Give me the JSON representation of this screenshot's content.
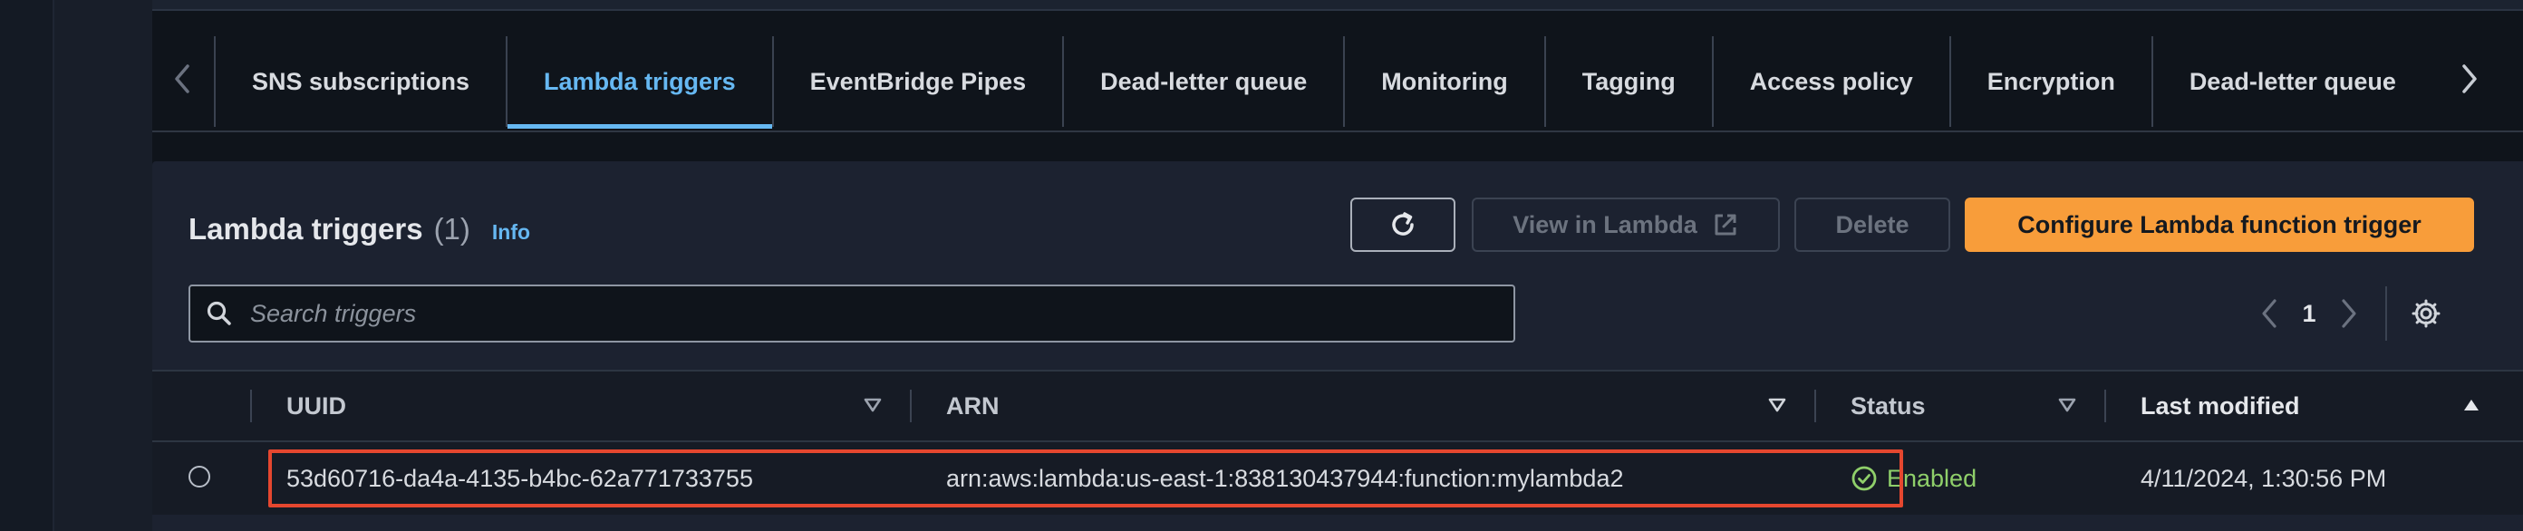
{
  "tabs": {
    "items": [
      {
        "label": "SNS subscriptions"
      },
      {
        "label": "Lambda triggers"
      },
      {
        "label": "EventBridge Pipes"
      },
      {
        "label": "Dead-letter queue"
      },
      {
        "label": "Monitoring"
      },
      {
        "label": "Tagging"
      },
      {
        "label": "Access policy"
      },
      {
        "label": "Encryption"
      },
      {
        "label": "Dead-letter queue"
      }
    ],
    "active_label": "Lambda triggers"
  },
  "panel": {
    "title": "Lambda triggers",
    "count": "(1)",
    "info_label": "Info",
    "view_label": "View in Lambda",
    "delete_label": "Delete",
    "configure_label": "Configure Lambda function trigger"
  },
  "search": {
    "placeholder": "Search triggers",
    "value": ""
  },
  "pagination": {
    "current_page": "1"
  },
  "table": {
    "columns": {
      "uuid": "UUID",
      "arn": "ARN",
      "status": "Status",
      "modified": "Last modified"
    },
    "rows": [
      {
        "uuid": "53d60716-da4a-4135-b4bc-62a771733755",
        "arn": "arn:aws:lambda:us-east-1:838130437944:function:mylambda2",
        "status": "Enabled",
        "modified": "4/11/2024, 1:30:56 PM"
      }
    ]
  },
  "colors": {
    "accent": "#66b8f2",
    "primary_button": "#f89d3a",
    "status_success": "#8fcf6a",
    "highlight_box": "#e5472f"
  },
  "icons": {
    "refresh": "refresh-icon",
    "external": "external-link-icon",
    "search": "search-icon",
    "settings": "gear-icon",
    "status": "check-circle-icon"
  }
}
